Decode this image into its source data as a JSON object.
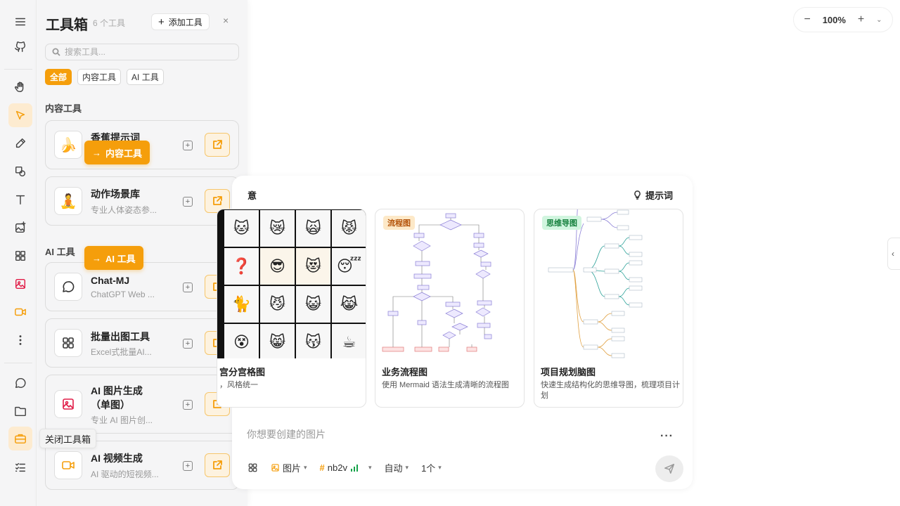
{
  "rail": {
    "items": [
      "menu-icon",
      "github-icon",
      "hand-icon",
      "cursor-icon",
      "pencil-icon",
      "shapes-icon",
      "text-icon",
      "image-add-icon",
      "grid-icon",
      "image-icon",
      "video-icon",
      "more-vertical-icon",
      "chat-icon",
      "folder-icon",
      "toolbox-icon",
      "checklist-icon"
    ],
    "active": "cursor-icon"
  },
  "toolbox": {
    "title": "工具箱",
    "count": "6 个工具",
    "add_label": "添加工具",
    "close_glyph": "×",
    "search_placeholder": "搜索工具...",
    "filters": [
      "全部",
      "内容工具",
      "AI 工具"
    ],
    "active_filter": "全部",
    "sections": {
      "content": "内容工具",
      "ai": "AI 工具"
    },
    "tools": [
      {
        "name": "香蕉提示词",
        "desc": "...",
        "icon": "banana-icon"
      },
      {
        "name": "动作场景库",
        "desc": "专业人体姿态参...",
        "icon": "pose-icon"
      },
      {
        "name": "Chat-MJ",
        "desc": "ChatGPT Web ...",
        "icon": "chat-icon"
      },
      {
        "name": "批量出图工具",
        "desc": "Excel式批量AI...",
        "icon": "grid-icon"
      },
      {
        "name": "AI 图片生成\n（单图）",
        "desc": "专业 AI 图片创...",
        "icon": "image-icon"
      },
      {
        "name": "AI 视频生成",
        "desc": "AI 驱动的短视频...",
        "icon": "video-icon"
      }
    ],
    "jump_content": "内容工具",
    "jump_ai": "AI 工具",
    "tooltip": "关闭工具箱"
  },
  "zoom": {
    "minus": "−",
    "value": "100%",
    "plus": "+"
  },
  "main": {
    "heading": "意",
    "hint_label": "提示词",
    "templates": [
      {
        "badge": "",
        "name": "宫分宫格图",
        "desc": "，风格统一"
      },
      {
        "badge": "流程图",
        "name": "业务流程图",
        "desc": "使用 Mermaid 语法生成清晰的流程图"
      },
      {
        "badge": "思维导图",
        "name": "项目规划脑图",
        "desc": "快速生成结构化的思维导图，梳理项目计划"
      }
    ],
    "prompt_placeholder": "你想要创建的图片",
    "options": {
      "type": "图片",
      "model": "nb2v",
      "mode": "自动",
      "count": "1个"
    }
  },
  "colors": {
    "accent": "#f59e0b",
    "flow_badge_bg": "#fde9c8",
    "mind_badge_bg": "#d1f5df"
  }
}
